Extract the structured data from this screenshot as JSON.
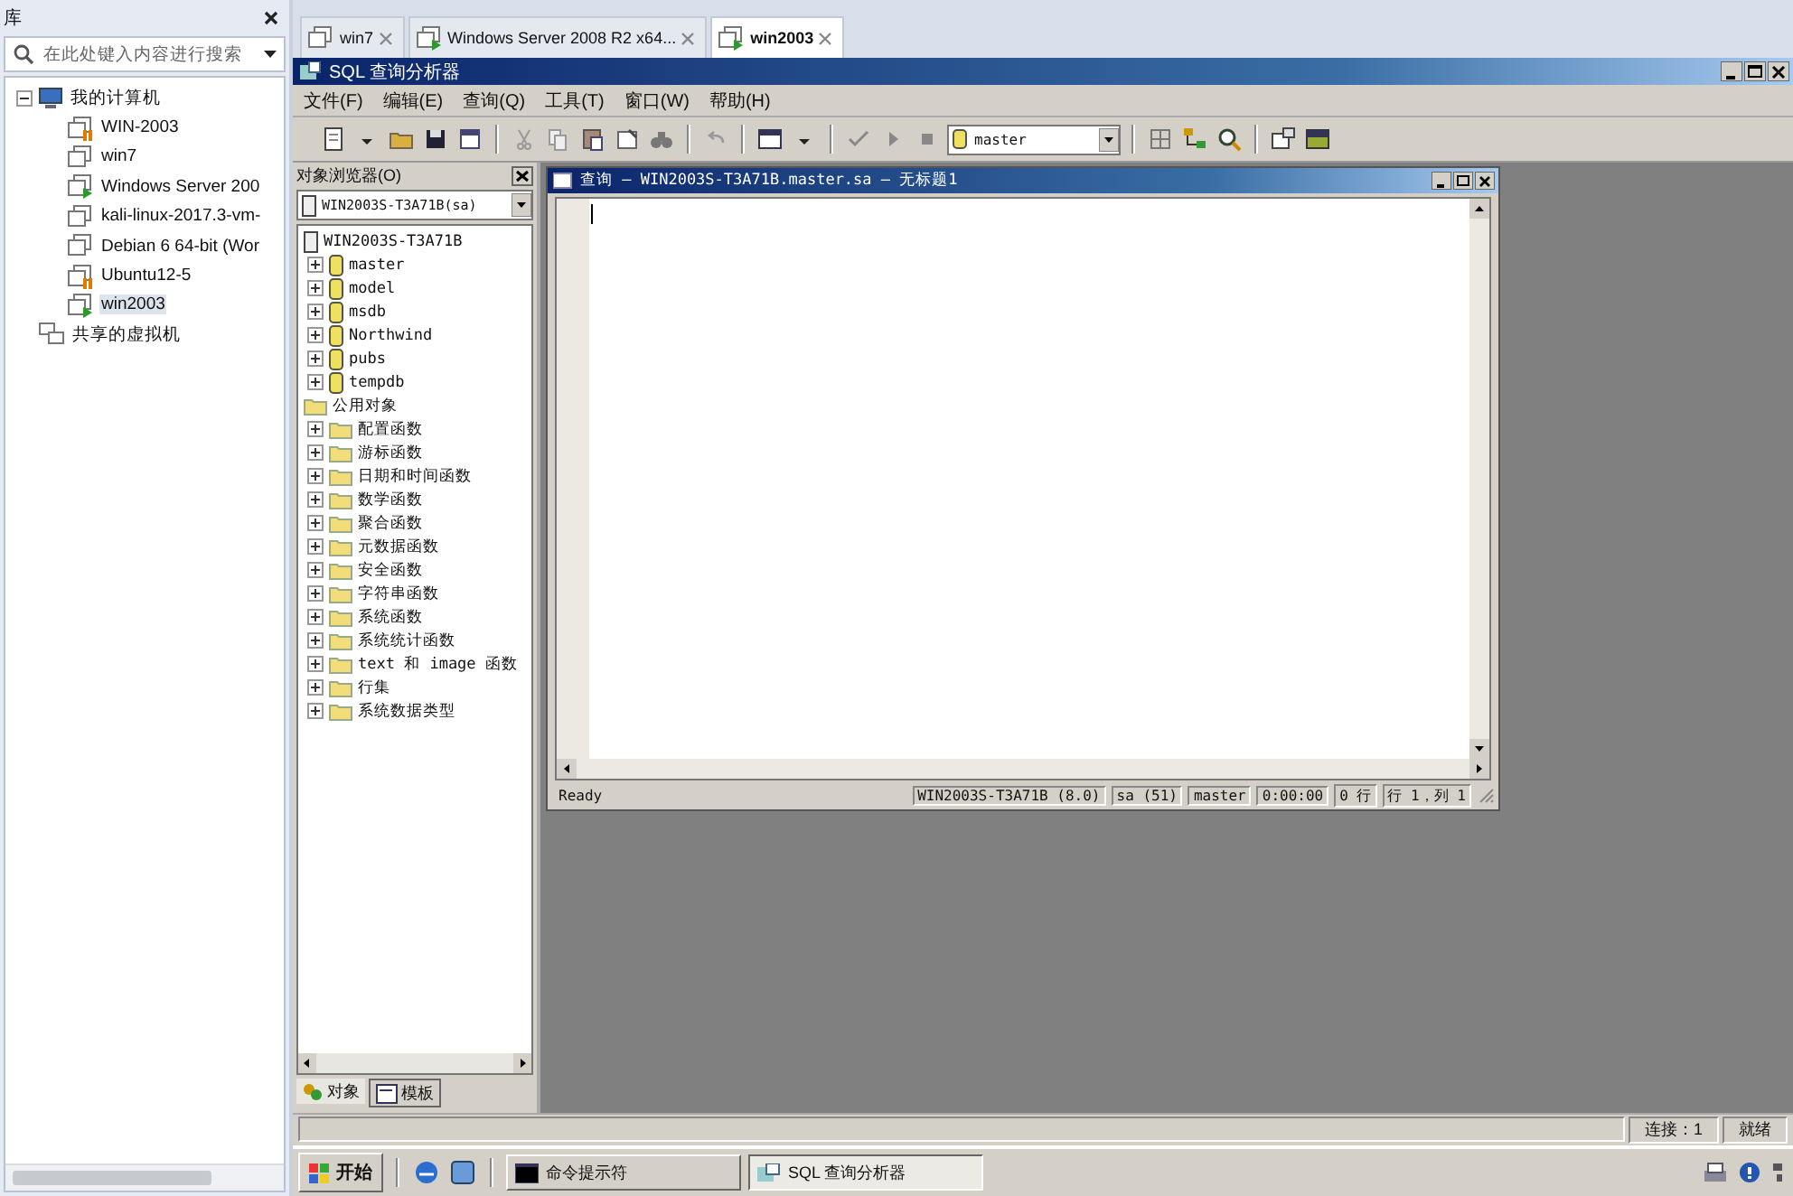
{
  "library": {
    "title": "库",
    "search": {
      "placeholder": "在此处键入内容进行搜索"
    },
    "tree": [
      {
        "label": "我的计算机",
        "kind": "computer",
        "expanded": true,
        "children": [
          {
            "label": "WIN-2003",
            "running": false,
            "paused": true,
            "selected": false
          },
          {
            "label": "win7",
            "running": false,
            "paused": false,
            "selected": false
          },
          {
            "label": "Windows Server 200",
            "running": true,
            "paused": false,
            "selected": false
          },
          {
            "label": "kali-linux-2017.3-vm-",
            "running": false,
            "paused": false,
            "selected": false
          },
          {
            "label": "Debian 6 64-bit (Wor",
            "running": false,
            "paused": false,
            "selected": false
          },
          {
            "label": "Ubuntu12-5",
            "running": false,
            "paused": true,
            "selected": false
          },
          {
            "label": "win2003",
            "running": true,
            "paused": false,
            "selected": true
          }
        ]
      },
      {
        "label": "共享的虚拟机",
        "kind": "shared"
      }
    ]
  },
  "tabs": [
    {
      "label": "win7",
      "running": false,
      "selected": false
    },
    {
      "label": "Windows Server 2008 R2 x64...",
      "running": true,
      "selected": false
    },
    {
      "label": "win2003",
      "running": true,
      "selected": true
    }
  ],
  "app": {
    "title": "SQL 查询分析器",
    "menu": [
      "文件(F)",
      "编辑(E)",
      "查询(Q)",
      "工具(T)",
      "窗口(W)",
      "帮助(H)"
    ],
    "database_select": "master",
    "object_browser": {
      "title": "对象浏览器(O)",
      "server_select": "WIN2003S-T3A71B(sa)",
      "tree": [
        {
          "label": "WIN2003S-T3A71B",
          "kind": "server",
          "children": [
            {
              "label": "master",
              "kind": "database",
              "expanded": false
            },
            {
              "label": "model",
              "kind": "database",
              "expanded": false
            },
            {
              "label": "msdb",
              "kind": "database",
              "expanded": false
            },
            {
              "label": "Northwind",
              "kind": "database",
              "expanded": false
            },
            {
              "label": "pubs",
              "kind": "database",
              "expanded": false
            },
            {
              "label": "tempdb",
              "kind": "database",
              "expanded": false
            }
          ]
        },
        {
          "label": "公用对象",
          "kind": "folder",
          "children": [
            {
              "label": "配置函数",
              "kind": "folder",
              "expanded": false
            },
            {
              "label": "游标函数",
              "kind": "folder",
              "expanded": false
            },
            {
              "label": "日期和时间函数",
              "kind": "folder",
              "expanded": false
            },
            {
              "label": "数学函数",
              "kind": "folder",
              "expanded": false
            },
            {
              "label": "聚合函数",
              "kind": "folder",
              "expanded": false
            },
            {
              "label": "元数据函数",
              "kind": "folder",
              "expanded": false
            },
            {
              "label": "安全函数",
              "kind": "folder",
              "expanded": false
            },
            {
              "label": "字符串函数",
              "kind": "folder",
              "expanded": false
            },
            {
              "label": "系统函数",
              "kind": "folder",
              "expanded": false
            },
            {
              "label": "系统统计函数",
              "kind": "folder",
              "expanded": false
            },
            {
              "label": "text 和 image 函数",
              "kind": "folder",
              "expanded": false
            },
            {
              "label": "行集",
              "kind": "folder",
              "expanded": false
            },
            {
              "label": "系统数据类型",
              "kind": "folder",
              "expanded": false
            }
          ]
        }
      ],
      "tabs": [
        {
          "label": "对象",
          "selected": true
        },
        {
          "label": "模板",
          "selected": false
        }
      ]
    },
    "query_window": {
      "title": "查询 — WIN2003S-T3A71B.master.sa — 无标题1",
      "status": [
        "Ready",
        "WIN2003S-T3A71B (8.0)",
        "sa (51)",
        "master",
        "0:00:00",
        "0 行",
        "行 1，列 1"
      ]
    },
    "status_bar": [
      "连接：1",
      "就绪"
    ]
  },
  "taskbar": {
    "start": "开始",
    "tasks": [
      {
        "label": "命令提示符",
        "kind": "console",
        "selected": false
      },
      {
        "label": "SQL 查询分析器",
        "kind": "sql",
        "selected": true
      }
    ]
  }
}
